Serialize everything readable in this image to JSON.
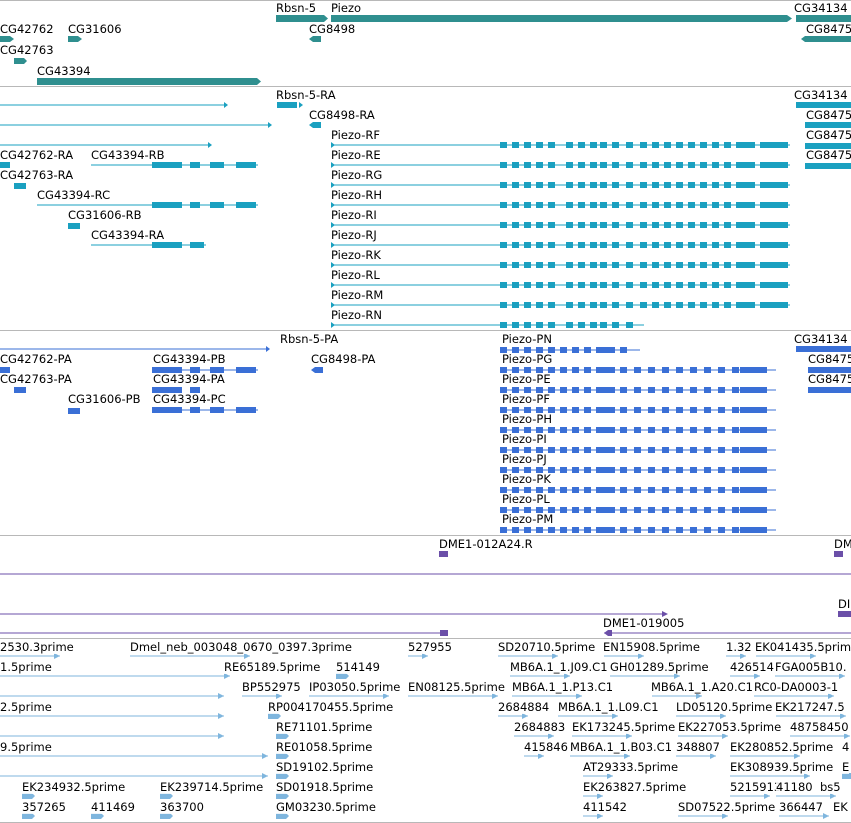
{
  "colors": {
    "genes": "#2f8f8f",
    "transcripts": "#1aa0c0",
    "proteins": "#3a6fd6",
    "primers": "#6b4fa8",
    "ests": "#7fb6de",
    "separator": "#b8b8b8"
  },
  "gene_track": {
    "labels": [
      "CG42762",
      "CG31606",
      "CG42763",
      "CG43394",
      "Rbsn-5",
      "Piezo",
      "CG8498",
      "CG34134",
      "CG8475"
    ]
  },
  "transcript_track": {
    "labels": [
      "Rbsn-5-RA",
      "CG8498-RA",
      "CG34134",
      "CG8475",
      "Piezo-RF",
      "CG8475",
      "CG42762-RA",
      "CG43394-RB",
      "Piezo-RE",
      "CG8475",
      "CG42763-RA",
      "Piezo-RG",
      "Piezo-RH",
      "CG43394-RC",
      "Piezo-RI",
      "CG31606-RB",
      "Piezo-RJ",
      "CG43394-RA",
      "Piezo-RK",
      "Piezo-RL",
      "Piezo-RM",
      "Piezo-RN"
    ]
  },
  "protein_track": {
    "labels": [
      "Rbsn-5-PA",
      "Piezo-PN",
      "CG34134",
      "CG42762-PA",
      "CG43394-PB",
      "CG8498-PA",
      "Piezo-PG",
      "CG8475",
      "CG42763-PA",
      "CG43394-PA",
      "Piezo-PE",
      "CG8475",
      "CG31606-PB",
      "CG43394-PC",
      "Piezo-PF",
      "Piezo-PH",
      "Piezo-PI",
      "Piezo-PJ",
      "Piezo-PK",
      "Piezo-PL",
      "Piezo-PM"
    ]
  },
  "primer_track": {
    "labels": [
      "DME1-012A24.R",
      "DM",
      "DME1-019005",
      "DI"
    ]
  },
  "est_track": {
    "labels": [
      "2530.3prime",
      "Dmel_neb_003048_0670_0397.3prime",
      "527955",
      "SD20710.5prime",
      "EN15908.5prime",
      "1.32",
      "EK041435.5prime",
      "1.5prime",
      "RE65189.5prime",
      "514149",
      "MB6A.1_1.J09.C1",
      "GH01289.5prime",
      "426514",
      "FGA005B10.",
      "BP552975",
      "IP03050.5prime",
      "EN08125.5prime",
      "MB6A.1_1.P13.C1",
      "MB6A.1_1.A20.C1",
      "RC0-DA0003-1",
      "2.5prime",
      "RP004170455.5prime",
      "2684884",
      "MB6A.1_1.L09.C1",
      "LD05120.5prime",
      "EK217247.5",
      "RE71101.5prime",
      "2684883",
      "EK173245.5prime",
      "EK227053.5prime",
      "48758450",
      "9.5prime",
      "RE01058.5prime",
      "415846",
      "MB6A.1_1.B03.C1",
      "348807",
      "EK280852.5prime",
      "4",
      "SD19102.5prime",
      "AT29333.5prime",
      "EK308939.5prime",
      "E",
      "EK234932.5prime",
      "EK239714.5prime",
      "SD01918.5prime",
      "EK263827.5prime",
      "5215913",
      "41180",
      "bs5",
      "357265",
      "411469",
      "363700",
      "GM03230.5prime",
      "411542",
      "SD07522.5prime",
      "366447",
      "EK"
    ]
  }
}
